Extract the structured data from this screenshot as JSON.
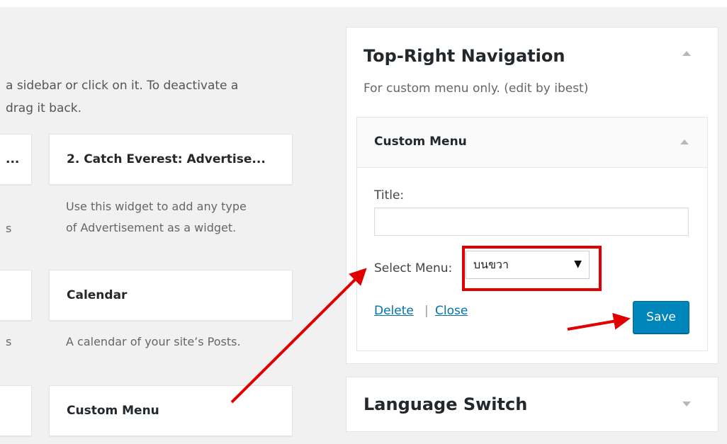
{
  "help_text": {
    "line1": "a sidebar or click on it. To deactivate a",
    "line2": "drag it back."
  },
  "available_widgets": [
    {
      "label": "...",
      "description": "s"
    },
    {
      "label": "2. Catch Everest: Advertise...",
      "description_lines": [
        "Use this widget to add any type",
        "of Advertisement as a widget."
      ]
    },
    {
      "label": "",
      "description": "s"
    },
    {
      "label": "Calendar",
      "description": "A calendar of your site’s Posts."
    },
    {
      "label": ""
    },
    {
      "label": "Custom Menu"
    }
  ],
  "sidebar_top_right": {
    "title": "Top-Right Navigation",
    "description": "For custom menu only. (edit by ibest)",
    "widget": {
      "title": "Custom Menu",
      "title_field_label": "Title:",
      "title_field_value": "",
      "select_menu_label": "Select Menu:",
      "select_menu_value": "บนขวา",
      "select_caret": "▼",
      "delete_label": "Delete",
      "separator": "|",
      "close_label": "Close",
      "save_label": "Save"
    }
  },
  "sidebar_language": {
    "title": "Language Switch"
  },
  "colors": {
    "background": "#f1f1f1",
    "primary_button": "#0085ba",
    "link": "#0073aa",
    "annotation_red": "#e00000"
  }
}
